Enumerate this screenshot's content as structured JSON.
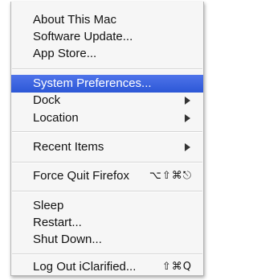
{
  "menu": {
    "items": {
      "about": {
        "label": "About This Mac"
      },
      "software_update": {
        "label": "Software Update..."
      },
      "app_store": {
        "label": "App Store..."
      },
      "system_prefs": {
        "label": "System Preferences..."
      },
      "dock": {
        "label": "Dock"
      },
      "location": {
        "label": "Location"
      },
      "recent_items": {
        "label": "Recent Items"
      },
      "force_quit": {
        "label": "Force Quit Firefox",
        "shortcut": "⌥⇧⌘⎋"
      },
      "sleep": {
        "label": "Sleep"
      },
      "restart": {
        "label": "Restart..."
      },
      "shut_down": {
        "label": "Shut Down..."
      },
      "log_out": {
        "label": "Log Out iClarified...",
        "shortcut": "⇧⌘Q"
      }
    },
    "selected_color": "#3a62e0",
    "submenu_icon": "chevron-right-icon"
  }
}
